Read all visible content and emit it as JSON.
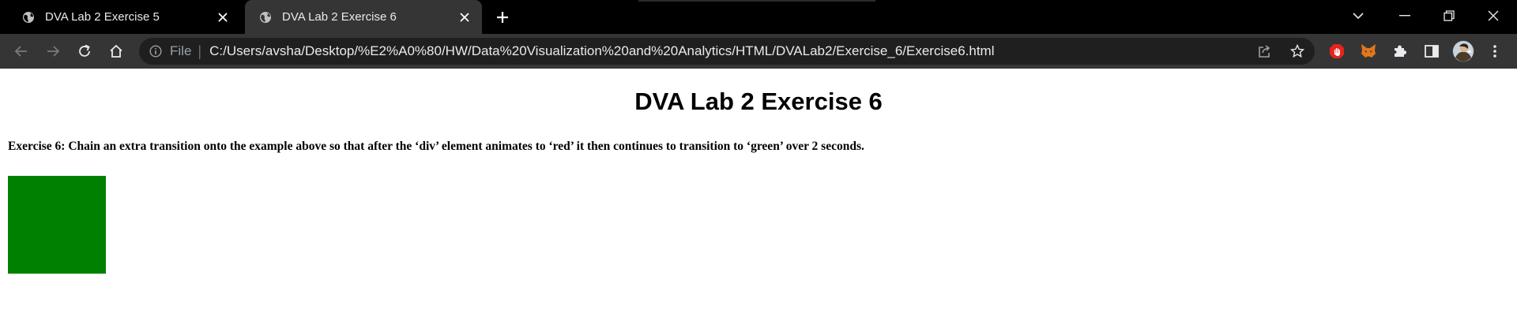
{
  "browser": {
    "tabs": [
      {
        "title": "DVA Lab 2 Exercise 5",
        "active": false
      },
      {
        "title": "DVA Lab 2 Exercise 6",
        "active": true
      }
    ],
    "address_bar": {
      "scheme_label": "File",
      "separator": "|",
      "url": "C:/Users/avsha/Desktop/%E2%A0%80/HW/Data%20Visualization%20and%20Analytics/HTML/DVALab2/Exercise_6/Exercise6.html"
    },
    "icons": {
      "favicon": "globe-icon",
      "close": "close-icon",
      "new_tab": "plus-icon",
      "tab_search": "chevron-down-icon",
      "minimize": "minimize-icon",
      "restore": "restore-icon",
      "window_close": "close-icon",
      "back": "back-arrow-icon",
      "forward": "forward-arrow-icon",
      "reload": "reload-icon",
      "home": "home-icon",
      "site_info": "info-icon",
      "share": "share-icon",
      "bookmark": "star-icon",
      "adblock": "stop-hand-icon",
      "metamask": "fox-icon",
      "extensions": "puzzle-icon",
      "side_panel": "side-panel-icon",
      "profile": "avatar",
      "menu": "kebab-menu-icon"
    },
    "colors": {
      "tabstrip_bg": "#000000",
      "toolbar_bg": "#353535",
      "omnibox_bg": "#1f1f1f",
      "text_light": "#e8eaed",
      "text_muted": "#9aa0a6"
    }
  },
  "page": {
    "heading": "DVA Lab 2 Exercise 6",
    "description": "Exercise 6: Chain an extra transition onto the example above so that after the ‘div’ element animates to ‘red’ it then continues to transition to ‘green’ over 2 seconds.",
    "box_color": "#008000"
  }
}
